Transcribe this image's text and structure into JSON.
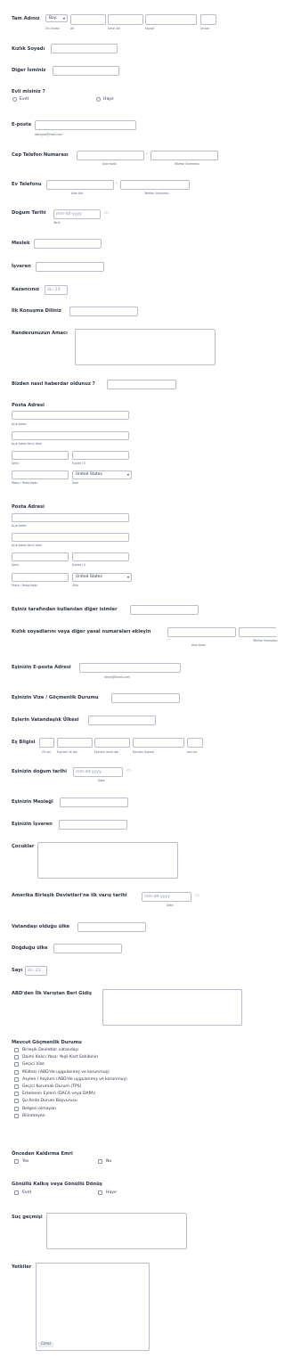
{
  "fields": {
    "full_name": {
      "label": "Tam Adınız",
      "prefix_value": "Bay.",
      "sub_prefix": "Ön Unvan",
      "sub_first": "Ad",
      "sub_middle": "İkinci Ad",
      "sub_last": "Soyad",
      "sub_suffix": "Unvan"
    },
    "maiden_name": {
      "label": "Kızlık Soyadı"
    },
    "other_names": {
      "label": "Diğer İsminiz"
    },
    "married": {
      "label": "Evli misiniz ?",
      "options": [
        "Evet",
        "Hayır"
      ]
    },
    "email": {
      "label": "E-posta",
      "hint": "abcsyad@mail.com"
    },
    "cell_phone": {
      "label": "Cep Telefon Numarası",
      "sub_area": "Alan Kodu",
      "sub_number": "Telefon Numarası",
      "dash": "-"
    },
    "home_phone": {
      "label": "Ev Telefonu",
      "sub_area": "Alan Ark",
      "sub_number": "Telefon Numarası",
      "dash": "-"
    },
    "birth_date": {
      "label": "Doğum Tarihi",
      "placeholder": "mm-dd-yyyy",
      "sub": "Tarih"
    },
    "occupation": {
      "label": "Meslek"
    },
    "employer": {
      "label": "İşveren"
    },
    "income": {
      "label": "Kazancınız",
      "placeholder": "ön: 23"
    },
    "first_language": {
      "label": "İlk Konuşma Diliniz"
    },
    "appointment_purpose": {
      "label": "Randevunuzun Amacı"
    },
    "heard_from": {
      "label": "Bizden nasıl haberdar oldunuz ?"
    },
    "address1": {
      "label": "Posta Adresi",
      "sub_street": "Açık Adres",
      "sub_street2": "Açık Adres İkinci Alan",
      "sub_city": "Şehir",
      "sub_state": "Eyalet / İl",
      "sub_zip": "Posta / Posta Kodu",
      "sub_country": "Ülke",
      "country_value": "United States"
    },
    "address2": {
      "label": "Posta Adresi",
      "sub_street": "Açık Adres",
      "sub_street2": "Açık Adres İkinci Alan",
      "sub_city": "Şehir",
      "sub_state": "Eyalet / İl",
      "sub_zip": "Posta / Posta Kodu",
      "sub_country": "Ülke",
      "country_value": "United States"
    },
    "spouse_other_names": {
      "label": "Eşiniz tarafından kullanılan diğer isimler"
    },
    "maiden_legal_numbers": {
      "label": "Kızlık soyadlarını veya diğer yasal numaraları ekleyin",
      "sub_area": "Alan Kodu",
      "sub_number": "Telefon Numarası",
      "dash": "-"
    },
    "spouse_email": {
      "label": "Eşinizin E-posta Adresi",
      "hint": "ömek@örnek.com"
    },
    "spouse_visa": {
      "label": "Eşinizin Vize / Göçmenlik Durumu"
    },
    "spouse_citizenship": {
      "label": "Eşlerin Vatandaşlık Ülkesi"
    },
    "spouse_info": {
      "label": "Eş Bilgisi",
      "sub_prefix": "Ön ad",
      "sub_first": "Eşinizin ilk adı",
      "sub_middle": "Eşinizin ikinci adı",
      "sub_last": "Eşinizin Soyadı",
      "sub_suffix": "son ad"
    },
    "spouse_birth": {
      "label": "Eşinizin doğum tarihi",
      "placeholder": "mm-dd-yyyy",
      "sub": "Date"
    },
    "spouse_occupation": {
      "label": "Eşinizin Mesleği"
    },
    "spouse_employer": {
      "label": "Eşinizin İşveren"
    },
    "children": {
      "label": "Çocuklar"
    },
    "us_entry_date": {
      "label": "Amerika Birleşik Devletleri'ne ilk varış tarihi",
      "placeholder": "mm-dd-yyyy",
      "sub": "Date"
    },
    "citizenship_country": {
      "label": "Vatandaşı olduğu ülke"
    },
    "birth_country": {
      "label": "Doğduğu ülke"
    },
    "count": {
      "label": "Sayı",
      "placeholder": "ön: 23"
    },
    "departures": {
      "label": "ABD'den İlk Varıştan Beri Gidiş"
    },
    "immigration_status": {
      "label": "Mevcut Göçmenlik Durumu",
      "options": [
        "Birleşik Devletler vatandaşı",
        "Daimi Kalıcı Yasa: Yeşil Kart Sahibinin",
        "Geçici Vize",
        "Mülteci (ABD'de uygulanmış ve korunmuş)",
        "Asylee / Asylum (ABD'de uygulanmış ve korunmuş)",
        "Geçici Korumalı Durum (TPS)",
        "Ertelenen Eylem (DACA veya DAPA)",
        "Şu Anda Durum Başvurusu",
        "Belgesi olmayan",
        "Bilinmeyen"
      ]
    },
    "prior_removal": {
      "label": "Önceden Kaldırma Emri",
      "options": [
        "Yes",
        "No"
      ]
    },
    "voluntary_departure": {
      "label": "Gönüllü Kalkış veya Gönüllü Dönüş",
      "options": [
        "Evet",
        "Hayır"
      ]
    },
    "criminal_history": {
      "label": "Suç geçmişi"
    },
    "authorized": {
      "label": "Yetkiler",
      "clear": "Clear"
    }
  },
  "icons": {
    "calendar": "calendar-icon",
    "select_arrow": "▾"
  },
  "colors": {
    "border": "#b8bdc9",
    "label": "#2c3345",
    "sublabel": "#57647e"
  }
}
